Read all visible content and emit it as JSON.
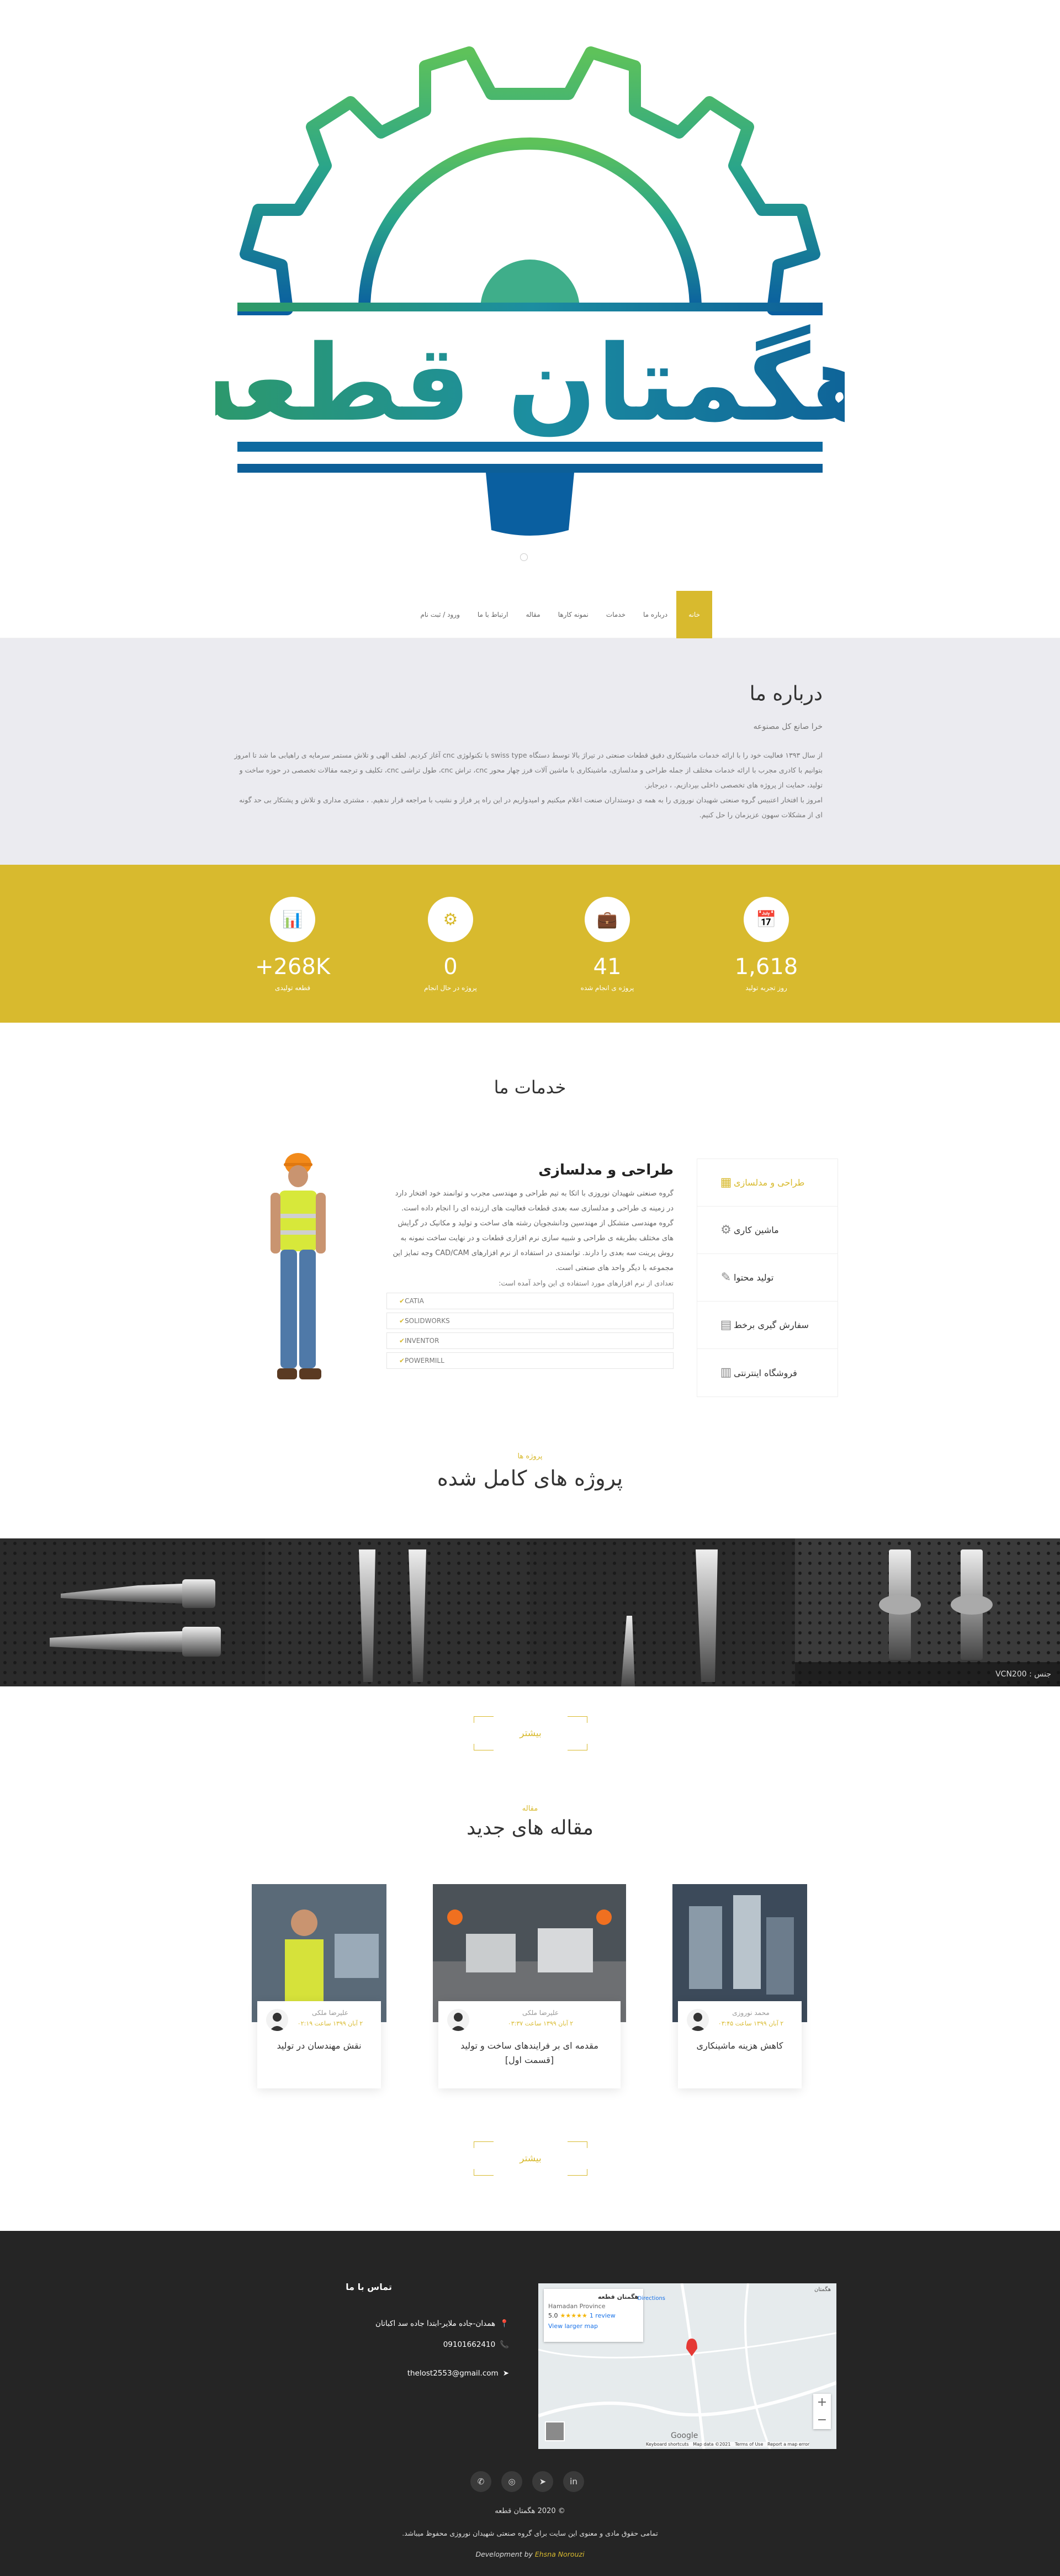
{
  "brand": {
    "logo_text": "هگمتان قطعه",
    "accent": "#d8ba2e"
  },
  "nav": {
    "items": [
      "خانه",
      "درباره ما",
      "خدمات",
      "نمونه کارها",
      "مقاله",
      "ارتباط با ما",
      "ورود / ثبت نام"
    ]
  },
  "about": {
    "title": "درباره ما",
    "subtitle": "خرا صانع کل مصنوعه",
    "p1": "از سال ۱۳۹۳ فعالیت خود را با ارائه خدمات ماشینکاری دقیق قطعات صنعتی در تیراژ بالا توسط دستگاه swiss type با تکنولوژی cnc آغاز کردیم. لطف الهی و تلاش مستمر سرمایه ی راهیابی ما شد تا امروز بتوانیم با کادری مجرب با ارائه خدمات مختلف از جمله طراحی و مدلسازی، ماشینکاری با ماشین آلات فرز چهار محور cnc، تراش cnc، طول تراشی cnc، تکلیف و ترجمه مقالات تخصصی در حوزه ساخت و تولید، حمایت از پروژه های تخصصی داخلی بپردازیم. ، دیرجابز.",
    "p2": "امروز با افتخار اعتبیس گروه صنعتی شهیدان نوروزی را به همه ی دوستداران صنعت اعلام میکنیم و امیدواریم در این راه پر فراز و نشیب با مراجعه قرار ندهیم. ، مشتری مداری و تلاش و پشتکار بی حد گونه ای از مشکلات سهون عزیزمان را حل کنیم."
  },
  "stats": [
    {
      "icon": "calendar-icon",
      "glyph": "📅",
      "num": "1,618",
      "label": "روز تجربه تولید"
    },
    {
      "icon": "briefcase-icon",
      "glyph": "💼",
      "num": "41",
      "label": "پروژه ی انجام شده"
    },
    {
      "icon": "gears-icon",
      "glyph": "⚙",
      "num": "0",
      "label": "پروژه در حال انجام"
    },
    {
      "icon": "chart-icon",
      "glyph": "📊",
      "num": "+268K",
      "label": "قطعه تولیدی"
    }
  ],
  "services": {
    "title": "خدمات ما",
    "tabs": [
      {
        "label": "طراحی و مدلسازی",
        "glyph": "▦"
      },
      {
        "label": "ماشین کاری",
        "glyph": "⚙"
      },
      {
        "label": "تولید محتوا",
        "glyph": "✎"
      },
      {
        "label": "سفارش گیری برخط",
        "glyph": "▤"
      },
      {
        "label": "فروشگاه اینترنتی",
        "glyph": "▥"
      }
    ],
    "active": {
      "heading": "طراحی و مدلسازی",
      "text": "گروه صنعتی شهیدان نوروزی با اتکا به تیم طراحی و مهندسی مجرب و توانمند خود افتخار دارد در زمینه ی طراحی و مدلسازی سه بعدی قطعات فعالیت های ارزنده ای را انجام داده است. گروه مهندسی متشکل از مهندسین ودانشجویان رشته های ساخت و تولید و مکانیک در گرایش های مختلف بطریقه ی طراحی و شبیه سازی نرم افزاری قطعات و در نهایت ساخت نمونه به روش پرینت سه بعدی را دارند. توانمندی در استفاده از نرم افزارهای CAD/CAM وجه تمایز این مجموعه با دیگر واحد های صنعتی است.",
      "note": "تعدادی از نرم افزارهای مورد استفاده ی این واحد آمده است:",
      "tools": [
        "CATIA",
        "SOLIDWORKS",
        "INVENTOR",
        "POWERMILL"
      ]
    }
  },
  "projects": {
    "kicker": "پروژه ها",
    "title": "پروژه های کامل شده",
    "caption": "جنس : VCN200",
    "more": "بیشتر"
  },
  "articles": {
    "kicker": "مقاله",
    "title": "مقاله های جدید",
    "more": "بیشتر",
    "items": [
      {
        "author": "محمد نوروزی",
        "date": "۲ آبان ۱۳۹۹ ساعت ۰۳:۴۵",
        "title": "کاهش هزینه ماشینکاری"
      },
      {
        "author": "علیرضا ملکی",
        "date": "۲ آبان ۱۳۹۹ ساعت ۰۳:۳۷",
        "title": "مقدمه ای بر فرایندهای ساخت و تولید [قسمت اول]"
      },
      {
        "author": "علیرضا ملکی",
        "date": "۲ آبان ۱۳۹۹ ساعت ۰۲:۱۹",
        "title": "نقش مهندسان در تولید"
      }
    ]
  },
  "footer": {
    "contact_title": "تماس با ما",
    "address": "همدان-جاده ملایر-ابتدا جاده سد اکباتان",
    "phone": "09101662410",
    "email": "thelost2553@gmail.com",
    "map": {
      "place": "هگمتان قطعه",
      "province": "Hamadan Province",
      "rating": "5.0",
      "stars": "★★★★★",
      "reviews": "1 review",
      "larger": "View larger map",
      "directions": "Directions",
      "google": "Google",
      "terms": "Keyboard shortcuts   Map data ©2021   Terms of Use   Report a map error",
      "label_top": "هگمتان"
    },
    "copyright": "© 2020 هگمتان قطعه",
    "rights": "تمامی حقوق مادی و معنوی این سایت برای گروه صنعتی شهیدان نوروزی محفوظ میباشد.",
    "dev_prefix": "Development by",
    "dev_name": "Ehsna Norouzi"
  }
}
